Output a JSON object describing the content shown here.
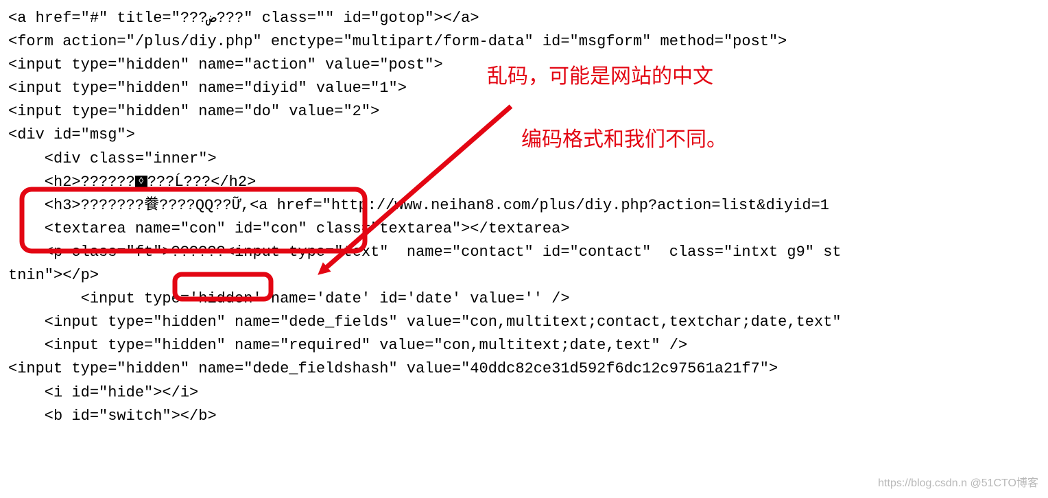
{
  "code": {
    "l01a": "<a href=\"#\" title=\"???",
    "l01b": "???\" class=\"\" id=\"gotop\"></a>",
    "l01title_mid": "ض",
    "l02": "<form action=\"/plus/diy.php\" enctype=\"multipart/form-data\" id=\"msgform\" method=\"post\">",
    "l03": "<input type=\"hidden\" name=\"action\" value=\"post\">",
    "l04": "<input type=\"hidden\" name=\"diyid\" value=\"1\">",
    "l05": "<input type=\"hidden\" name=\"do\" value=\"2\">",
    "l06": "<div id=\"msg\">",
    "l07": "    <div class=\"inner\">",
    "l08a": "    <h2>??????",
    "l08b": "???Ĺ???</h2>",
    "l09a": "    <h3>???????餋????QQ??Ữ,",
    "l09b": "<a href=\"http://www.neihan8.com/plus/diy.php?action=list&diyid=1",
    "l10": "    <textarea name=\"con\" id=\"con\" class=\"textarea\"></textarea>",
    "l11a": "    <p class=\"ft\"",
    "l11b": ">??????<",
    "l11c": "input type=\"text\"  name=\"contact\" id=\"contact\"  class=\"intxt g9\" st",
    "l12": "tnin\"></p>",
    "l13": "        <input type='hidden' name='date' id='date' value='' />",
    "l14": "    <input type=\"hidden\" name=\"dede_fields\" value=\"con,multitext;contact,textchar;date,text\"",
    "l15": "    <input type=\"hidden\" name=\"required\" value=\"con,multitext;date,text\" />",
    "l16": "<input type=\"hidden\" name=\"dede_fieldshash\" value=\"40ddc82ce31d592f6dc12c97561a21f7\">",
    "l17": "    <i id=\"hide\"></i>",
    "l18": "    <b id=\"switch\"></b>"
  },
  "annotation": {
    "line1": "乱码，可能是网站的中文",
    "line2": "编码格式和我们不同。"
  },
  "watermark": "https://blog.csdn.n @51CTO博客"
}
